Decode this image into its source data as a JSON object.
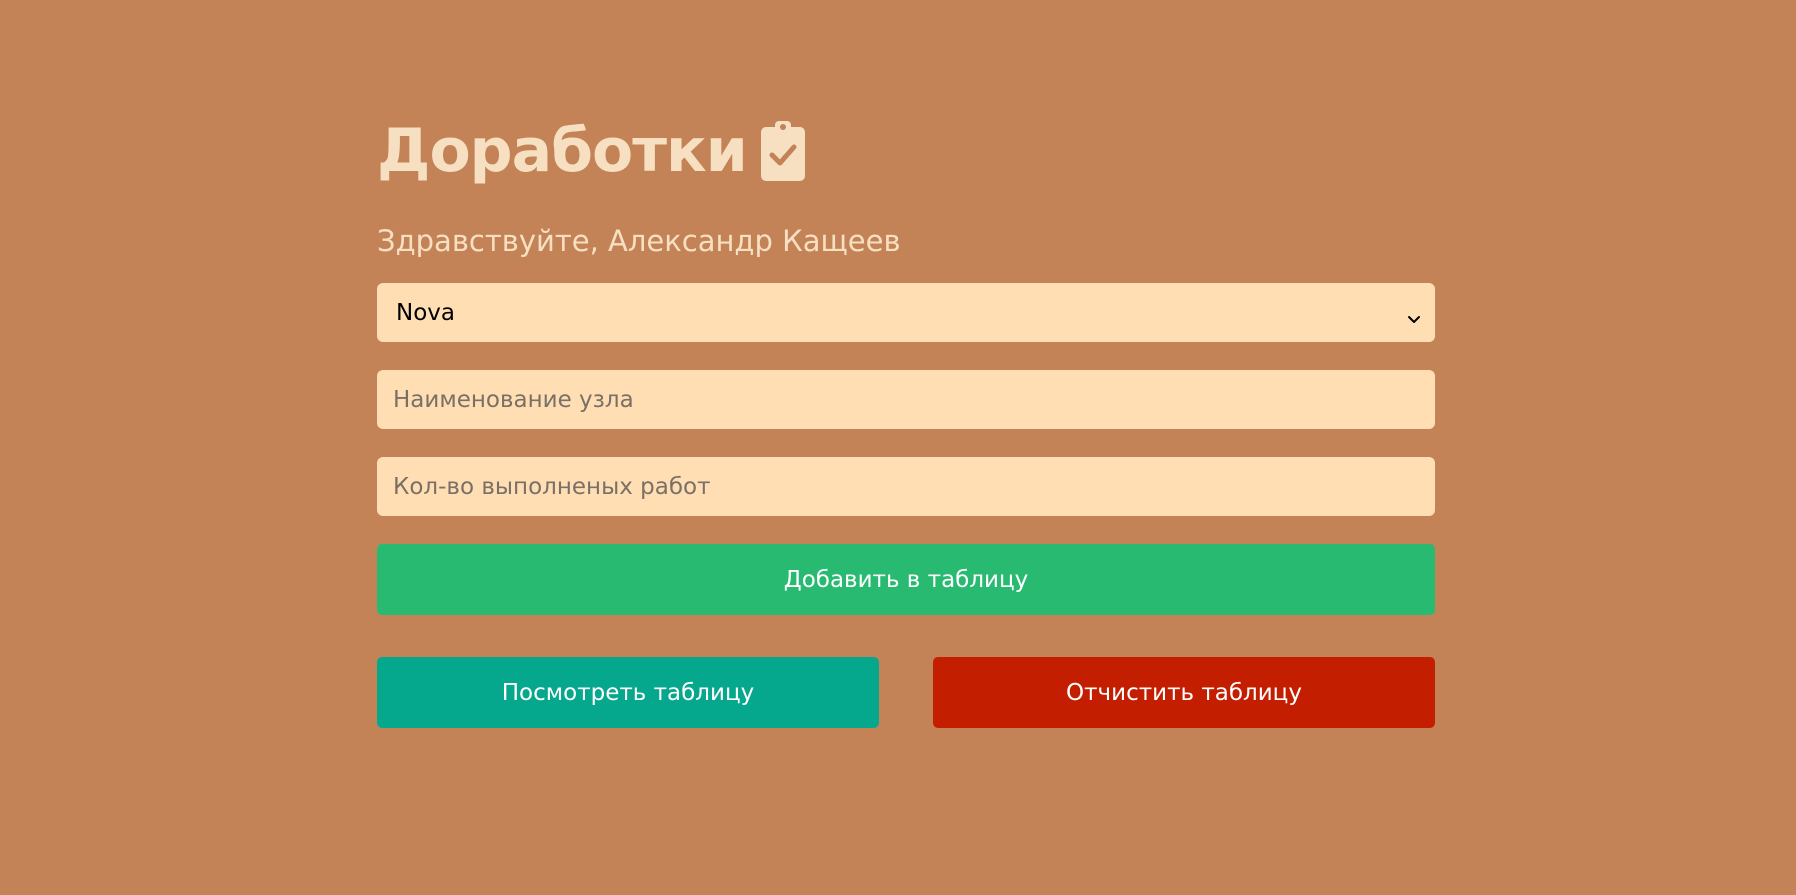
{
  "app": {
    "title": "Доработки",
    "title_icon": "clipboard-check-icon"
  },
  "greeting": "Здравствуйте, Александр Кащеев",
  "form": {
    "project_select": {
      "value": "Nova",
      "icon": "chevron-down-icon"
    },
    "node_name": {
      "placeholder": "Наименование узла",
      "value": ""
    },
    "works_count": {
      "placeholder": "Кол-во выполненых работ",
      "value": ""
    }
  },
  "buttons": {
    "add": "Добавить в таблицу",
    "view": "Посмотреть таблицу",
    "clear": "Отчистить таблицу"
  },
  "colors": {
    "background": "#c38357",
    "field": "#ffdeb4",
    "title_text": "#f7dfc2",
    "add_button": "#29ba71",
    "view_button": "#06a88d",
    "clear_button": "#c31e00"
  }
}
